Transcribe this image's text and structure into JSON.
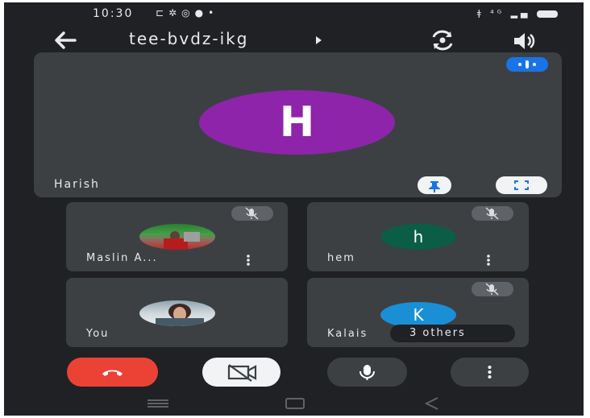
{
  "status_bar": {
    "time": "10:30",
    "icons": [
      "cast-icon",
      "settings-icon",
      "whatsapp-icon",
      "video-icon",
      "dot-icon"
    ],
    "right_icons": [
      "network-icon",
      "signal-icon",
      "battery-icon"
    ],
    "network_label": "Ⅱ ⁴⁶⁺⁵ᴵ"
  },
  "toolbar": {
    "meeting_code": "tee-bvdz-ikg"
  },
  "main_tile": {
    "avatar_letter": "H",
    "name": "Harish",
    "avatar_color": "#8e24aa"
  },
  "participants": [
    {
      "name": "Maslin A...",
      "avatar_type": "photo"
    },
    {
      "name": "hem",
      "avatar_letter": "h",
      "avatar_color": "#0b5d45"
    },
    {
      "name": "You",
      "avatar_type": "photo"
    },
    {
      "name": "Kalais",
      "avatar_letter": "K",
      "avatar_color": "#1a8fd6"
    }
  ],
  "others_chip": {
    "label": "3 others"
  },
  "colors": {
    "background": "#202124",
    "tile": "#3c4043",
    "end_call": "#ea4335",
    "accent": "#1a73e8"
  }
}
